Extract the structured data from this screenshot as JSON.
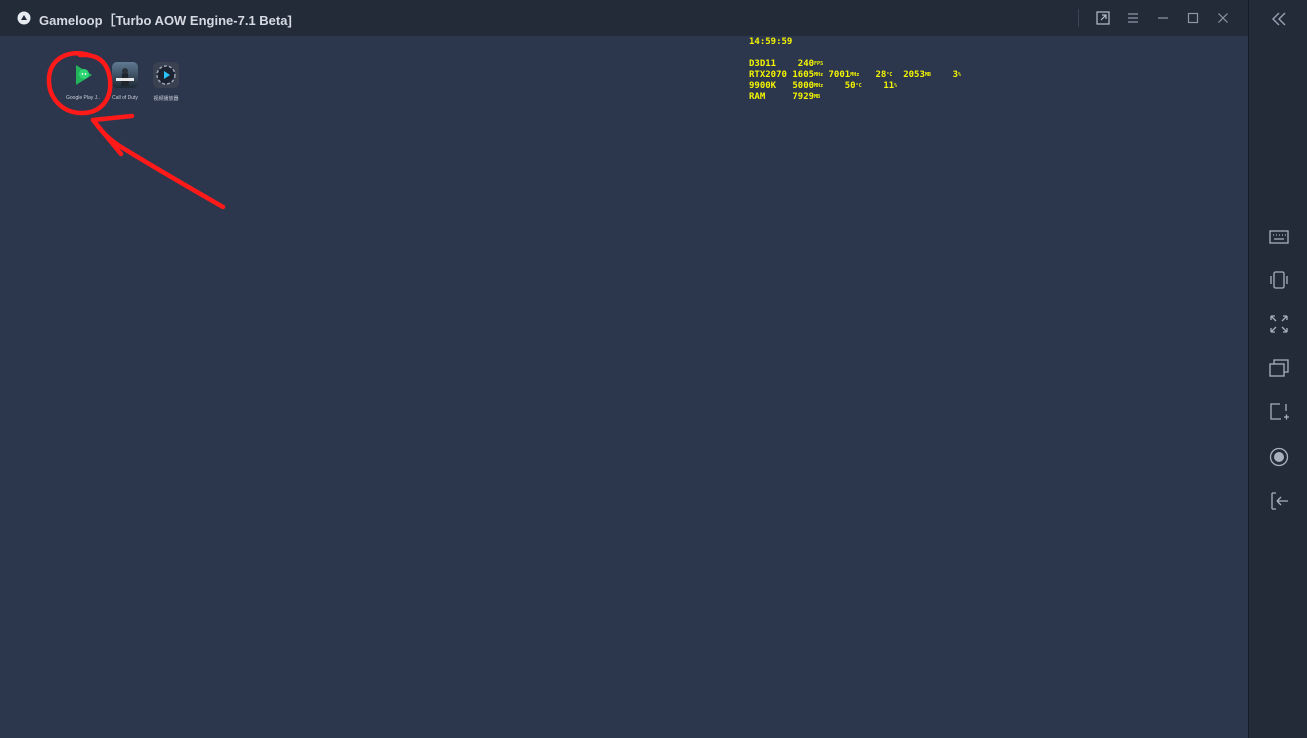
{
  "window": {
    "title": "Gameloop［Turbo AOW Engine-7.1 Beta]"
  },
  "title_buttons": [
    "external-window-icon",
    "menu-icon",
    "minimize-icon",
    "maximize-icon",
    "close-icon"
  ],
  "desktop_apps": [
    {
      "label": "Google Play J...",
      "icon": "google-play-games-icon"
    },
    {
      "label": "Call of Duty",
      "icon": "call-of-duty-icon"
    },
    {
      "label": "视频播放器",
      "icon": "video-player-icon"
    }
  ],
  "overlay": {
    "time": "14:59:59",
    "d3d": {
      "api": "D3D11",
      "fps": "240",
      "fps_unit": "FPS"
    },
    "gpu": {
      "name": "RTX2070",
      "core": "1605",
      "core_unit": "MHz",
      "mem": "7001",
      "mem_unit": "MHz",
      "temp": "28",
      "temp_unit": "°C",
      "vram": "2053",
      "vram_unit": "MB",
      "load": "3",
      "load_unit": "%"
    },
    "cpu": {
      "name": "9900K",
      "clock": "5000",
      "clock_unit": "MHz",
      "temp": "50",
      "temp_unit": "°C",
      "load": "11",
      "load_unit": "%"
    },
    "ram": {
      "name": "RAM",
      "used": "7929",
      "used_unit": "MB"
    }
  },
  "sidebar_buttons": [
    "collapse-icon",
    "keyboard-icon",
    "shake-icon",
    "fullscreen-icon",
    "multi-window-icon",
    "screenshot-icon",
    "record-icon",
    "exit-icon"
  ],
  "colors": {
    "annotation": "#ff1a1a",
    "overlay_text": "#f5f500",
    "desktop": "#2c374d",
    "chrome": "#232b39"
  }
}
